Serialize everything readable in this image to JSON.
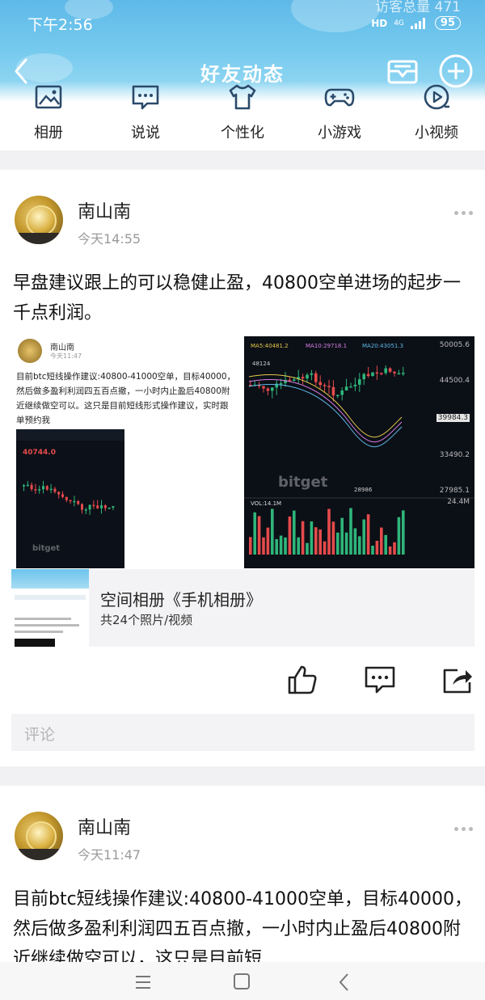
{
  "status_bar": {
    "time": "下午2:56",
    "visits_label": "访客总量 471",
    "hd": "HD",
    "network": "4G",
    "battery": "95"
  },
  "nav": {
    "title": "好友动态"
  },
  "quick_menu": [
    {
      "label": "相册",
      "icon": "photo-album-icon"
    },
    {
      "label": "说说",
      "icon": "speech-bubble-icon"
    },
    {
      "label": "个性化",
      "icon": "tshirt-icon"
    },
    {
      "label": "小游戏",
      "icon": "gamepad-icon"
    },
    {
      "label": "小视频",
      "icon": "video-play-icon"
    }
  ],
  "post1": {
    "author": "南山南",
    "time": "今天14:55",
    "text": "早盘建议跟上的可以稳健止盈，40800空单进场的起步一千点利润。",
    "image1": {
      "name": "南山南",
      "time": "今天11:47",
      "text": "目前btc短线操作建议:40800-41000空单，目标40000，然后做多盈利利润四五百点撤，一小时内止盈后40800附近继续做空可以。这只是目前短线形式操作建议，实时跟单预约我",
      "phone_price": "40744.0",
      "watermark": "bitget"
    },
    "image2": {
      "axis_labels": [
        "50005.6",
        "44500.4",
        "39984.3",
        "33490.2",
        "27985.1",
        "24.4M"
      ],
      "low_label": "28986",
      "high_label": "48124",
      "watermark": "bitget",
      "vol_label": "VOL:14.1M",
      "ma_labels": [
        "MA5:40481.2",
        "MA10:29718.1",
        "MA20:43051.3"
      ]
    },
    "album": {
      "title": "空间相册《手机相册》",
      "subtitle": "共24个照片/视频"
    },
    "comment_placeholder": "评论"
  },
  "post2": {
    "author": "南山南",
    "time": "今天11:47",
    "text": "目前btc短线操作建议:40800-41000空单，目标40000，然后做多盈利利润四五百点撤，一小时内止盈后40800附近继续做空可以，这只是目前短"
  },
  "colors": {
    "header_blue": "#6cc3ec",
    "bullish": "#2fb57a",
    "bearish": "#e54b4b"
  }
}
